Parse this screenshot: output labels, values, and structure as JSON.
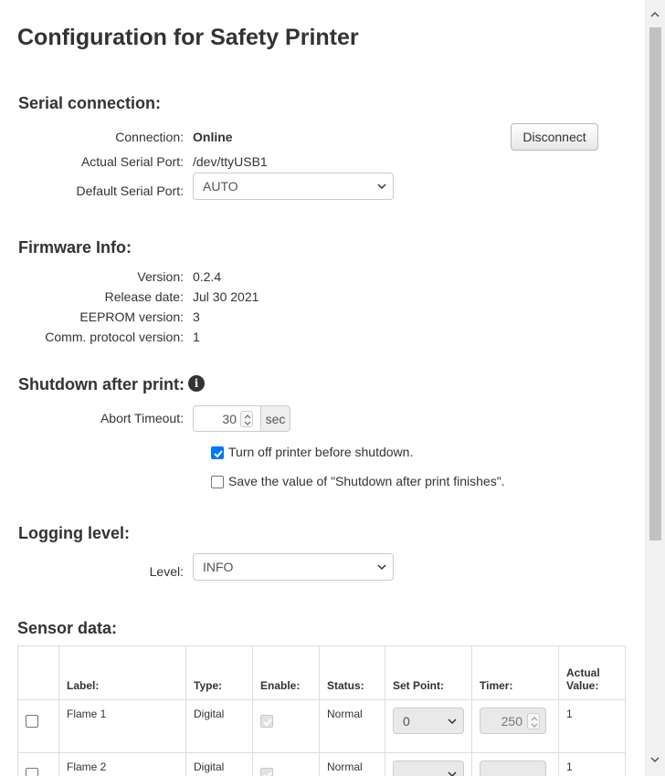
{
  "title": "Configuration for Safety Printer",
  "serial": {
    "heading": "Serial connection:",
    "connection_label": "Connection:",
    "connection_value": "Online",
    "disconnect_label": "Disconnect",
    "actual_port_label": "Actual Serial Port:",
    "actual_port_value": "/dev/ttyUSB1",
    "default_port_label": "Default Serial Port:",
    "default_port_value": "AUTO"
  },
  "firmware": {
    "heading": "Firmware Info:",
    "rows": [
      {
        "label": "Version:",
        "value": "0.2.4"
      },
      {
        "label": "Release date:",
        "value": "Jul 30 2021"
      },
      {
        "label": "EEPROM version:",
        "value": "3"
      },
      {
        "label": "Comm. protocol version:",
        "value": "1"
      }
    ]
  },
  "shutdown": {
    "heading": "Shutdown after print:",
    "abort_label": "Abort Timeout:",
    "abort_value": "30",
    "abort_unit": "sec",
    "turn_off_label": "Turn off printer before shutdown.",
    "turn_off_checked": true,
    "save_label": "Save the value of \"Shutdown after print finishes\".",
    "save_checked": false
  },
  "logging": {
    "heading": "Logging level:",
    "level_label": "Level:",
    "level_value": "INFO"
  },
  "sensors": {
    "heading": "Sensor data:",
    "columns": [
      "Label:",
      "Type:",
      "Enable:",
      "Status:",
      "Set Point:",
      "Timer:",
      "Actual Value:"
    ],
    "rows": [
      {
        "label": "Flame 1",
        "type": "Digital",
        "enabled": true,
        "status": "Normal",
        "set_point": "0",
        "timer": "250",
        "actual": "1"
      },
      {
        "label": "Flame 2",
        "type": "Digital",
        "enabled": true,
        "status": "Normal",
        "set_point": "",
        "timer": "",
        "actual": "1"
      }
    ]
  },
  "colors": {
    "checkbox_accent": "#0075ff",
    "scrollbar_thumb": "#c1c1c1"
  }
}
